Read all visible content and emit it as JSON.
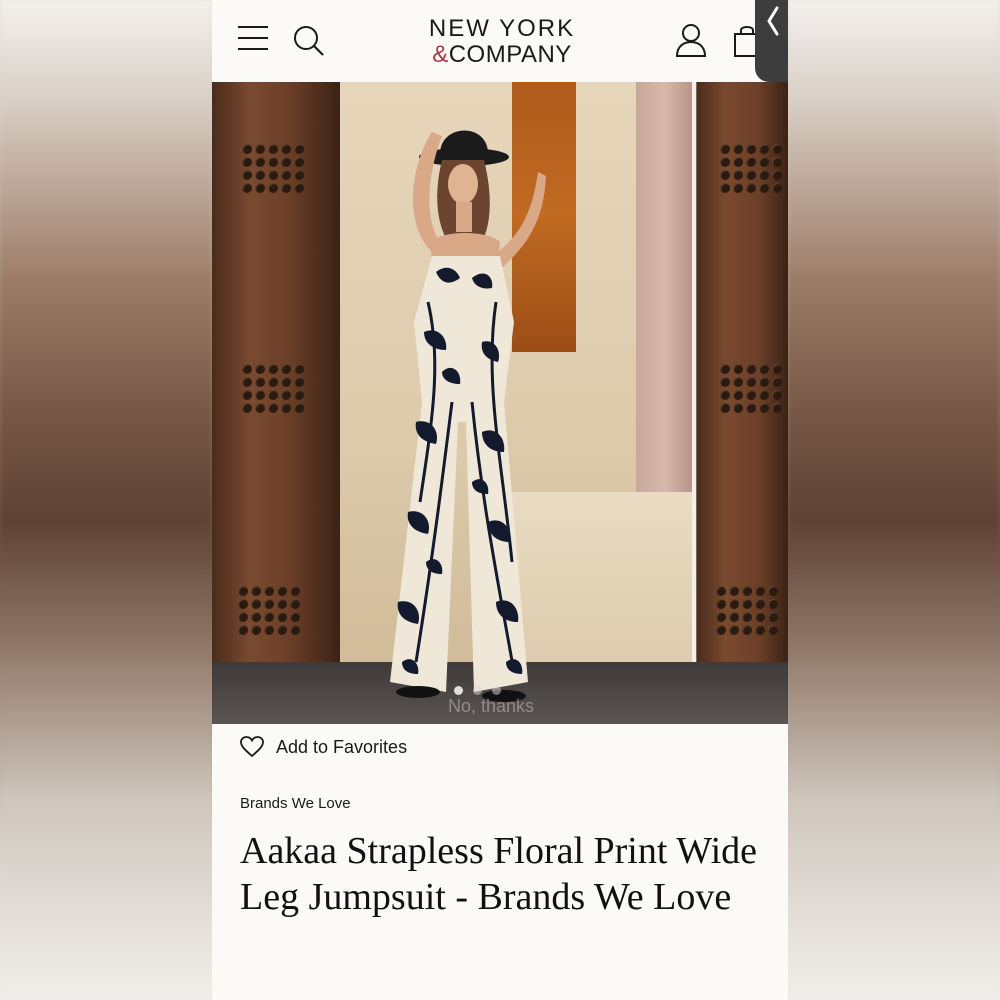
{
  "header": {
    "logo_line1": "NEW YORK",
    "logo_amp": "&",
    "logo_line2": "COMPANY",
    "icons": [
      "hamburger-menu-icon",
      "search-icon",
      "account-icon",
      "shopping-bag-icon",
      "chevron-left-icon"
    ]
  },
  "gallery": {
    "overlay_text": "No, thanks",
    "dots_count": 3,
    "active_dot": 0
  },
  "favorites": {
    "label": "Add to Favorites",
    "icon": "heart-icon"
  },
  "product": {
    "brand": "Brands We Love",
    "title": "Aakaa Strapless Floral Print Wide Leg Jumpsuit - Brands We Love"
  },
  "colors": {
    "background": "#fbfaf6",
    "text": "#1a1a1a",
    "logo_accent": "#b0344a",
    "side_tab": "#3d3d3d"
  }
}
